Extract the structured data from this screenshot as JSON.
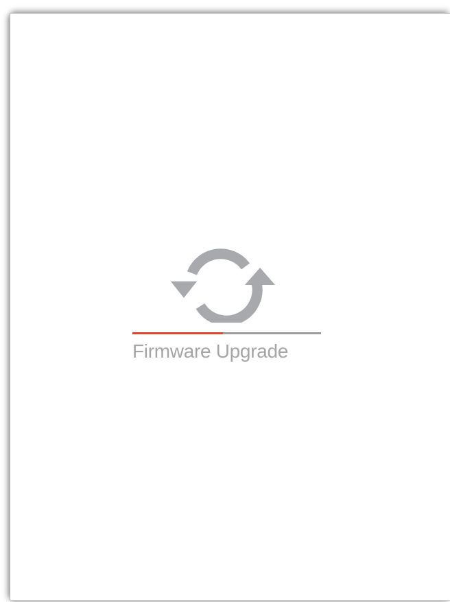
{
  "status": {
    "icon": "sync-arrows-icon",
    "label": "Firmware Upgrade"
  },
  "progress": {
    "fraction": 0.48,
    "fill_color": "#e1452d",
    "track_color": "#9d9d9d"
  },
  "colors": {
    "icon": "#a7a9ac",
    "text": "#a6a6a6",
    "background": "#ffffff"
  }
}
